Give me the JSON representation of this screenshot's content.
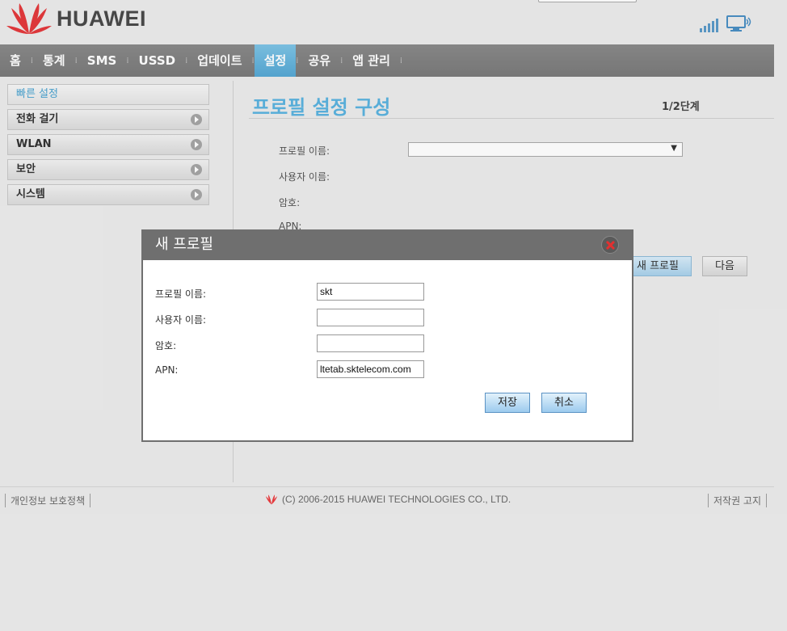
{
  "header": {
    "brand": "HUAWEI",
    "icons": [
      "huawei-logo-icon",
      "signal-icon",
      "pc-connection-icon"
    ]
  },
  "nav": {
    "items": [
      {
        "label": "홈",
        "active": false
      },
      {
        "label": "통계",
        "active": false
      },
      {
        "label": "SMS",
        "active": false
      },
      {
        "label": "USSD",
        "active": false
      },
      {
        "label": "업데이트",
        "active": false
      },
      {
        "label": "설정",
        "active": true
      },
      {
        "label": "공유",
        "active": false
      },
      {
        "label": "앱 관리",
        "active": false
      }
    ]
  },
  "sidebar": {
    "items": [
      {
        "label": "빠른 설정"
      },
      {
        "label": "전화 걸기"
      },
      {
        "label": "WLAN"
      },
      {
        "label": "보안"
      },
      {
        "label": "시스템"
      }
    ]
  },
  "main": {
    "title": "프로필 설정 구성",
    "step": "1/2단계",
    "fields": {
      "profile_name": "프로필 이름:",
      "user_name": "사용자 이름:",
      "password": "암호:",
      "apn": "APN:"
    },
    "new_profile_button": "새 프로필",
    "next_button": "다음"
  },
  "dialog": {
    "title": "새 프로필",
    "labels": {
      "profile_name": "프로필 이름:",
      "user_name": "사용자 이름:",
      "password": "암호:",
      "apn": "APN:"
    },
    "values": {
      "profile_name": "skt",
      "user_name": "",
      "password": "",
      "apn": "ltetab.sktelecom.com"
    },
    "save_button": "저장",
    "cancel_button": "취소"
  },
  "footer": {
    "privacy": "개인정보 보호정책",
    "copyright": "(C) 2006-2015 HUAWEI TECHNOLOGIES CO., LTD.",
    "copyright_notice": "저작권 고지"
  },
  "colors": {
    "accent": "#5bb3df",
    "nav_bg": "#808080",
    "dialog_header": "#6f6f6f",
    "brand_red": "#e4393c"
  }
}
